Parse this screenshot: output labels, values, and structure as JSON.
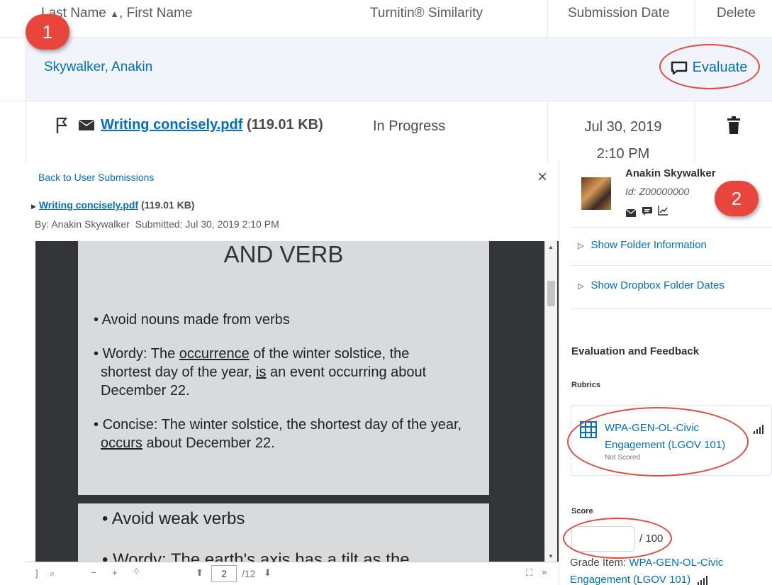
{
  "table": {
    "headers": {
      "name": "Last Name",
      "name_suffix": ", First Name",
      "similarity": "Turnitin® Similarity",
      "date": "Submission Date",
      "delete": "Delete"
    },
    "student_name": "Skywalker, Anakin",
    "evaluate_label": "Evaluate",
    "file_name": "Writing concisely.pdf",
    "file_size": "(119.01 KB)",
    "status": "In Progress",
    "date_line1": "Jul 30, 2019",
    "date_line2": "2:10 PM"
  },
  "annotations": {
    "bubble1": "1",
    "bubble2": "2",
    "color": "#e8453c"
  },
  "viewer": {
    "back_link": "Back to User Submissions",
    "file_name": "Writing concisely.pdf",
    "file_size": "(119.01 KB)",
    "by_line": "By: Anakin Skywalker  Submitted: Jul 30, 2019 2:10 PM",
    "close": "×",
    "slide1": {
      "heading": "AND VERB",
      "bullet1": "Avoid nouns made from verbs",
      "bullet2_prefix": "Wordy:  The ",
      "bullet2_u1": "occurrence",
      "bullet2_mid": " of the winter solstice, the shortest day of the year, ",
      "bullet2_u2": "is",
      "bullet2_end": " an event occurring about December 22.",
      "bullet3_prefix": "Concise:  The winter solstice, the shortest day of the year, ",
      "bullet3_u": "occurs",
      "bullet3_end": " about December 22."
    },
    "slide2": {
      "bullet1": "Avoid weak verbs",
      "bullet2": "Wordy:  The earth's axis has a tilt as the"
    },
    "toolbar": {
      "page_value": "2",
      "page_total": "/12"
    }
  },
  "side": {
    "user_name": "Anakin Skywalker",
    "user_id": "Id: Z00000000",
    "show_folder_info": "Show Folder Information",
    "show_dropbox_dates": "Show Dropbox Folder Dates",
    "eval_heading": "Evaluation and Feedback",
    "rubrics_label": "Rubrics",
    "rubric_name": "WPA-GEN-OL-Civic Engagement (LGOV 101)",
    "rubric_status": "Not Scored",
    "score_label": "Score",
    "score_value": "",
    "score_max": "/ 100",
    "grade_item_label": "Grade Item: ",
    "grade_item_link1": "WPA-GEN-OL-Civic",
    "grade_item_link2": "Engagement (LGOV 101)"
  },
  "icons": {
    "sort": "sort-up-icon",
    "evaluate": "speech-bubble-icon",
    "flag": "flag-icon",
    "mail": "envelope-icon",
    "trash": "trash-icon",
    "close": "close-icon",
    "expand": "triangle-right-icon",
    "rubric": "grid-icon",
    "stats": "bar-chart-icon"
  }
}
